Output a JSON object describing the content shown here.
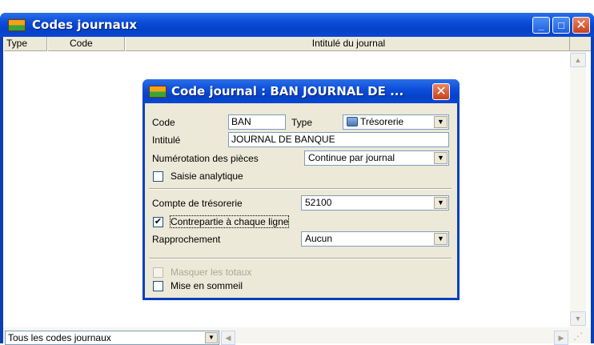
{
  "window": {
    "title": "Codes journaux",
    "minimize": "_",
    "maximize": "□",
    "close": "✕"
  },
  "list": {
    "columns": [
      "Type",
      "Code",
      "Intitulé du journal"
    ]
  },
  "footer": {
    "filter_value": "Tous les codes journaux"
  },
  "dialog": {
    "title": "Code journal : BAN JOURNAL DE ...",
    "close": "✕",
    "code_label": "Code",
    "code_value": "BAN",
    "type_label": "Type",
    "type_value": "Trésorerie",
    "intitule_label": "Intitulé",
    "intitule_value": "JOURNAL DE BANQUE",
    "numerotation_label": "Numérotation des pièces",
    "numerotation_value": "Continue par journal",
    "saisie_label": "Saisie analytique",
    "saisie_checked": false,
    "compte_label": "Compte de trésorerie",
    "compte_value": "52100",
    "contrepartie_label": "Contrepartie à chaque ligne",
    "contrepartie_checked": true,
    "rapprochement_label": "Rapprochement",
    "rapprochement_value": "Aucun",
    "masquer_label": "Masquer les totaux",
    "masquer_checked": false,
    "sommeil_label": "Mise en sommeil",
    "sommeil_checked": false
  },
  "icons": {
    "dropdown": "▼",
    "check": "✔",
    "scroll_up": "▲",
    "scroll_down": "▼",
    "scroll_left": "◀",
    "scroll_right": "▶"
  }
}
